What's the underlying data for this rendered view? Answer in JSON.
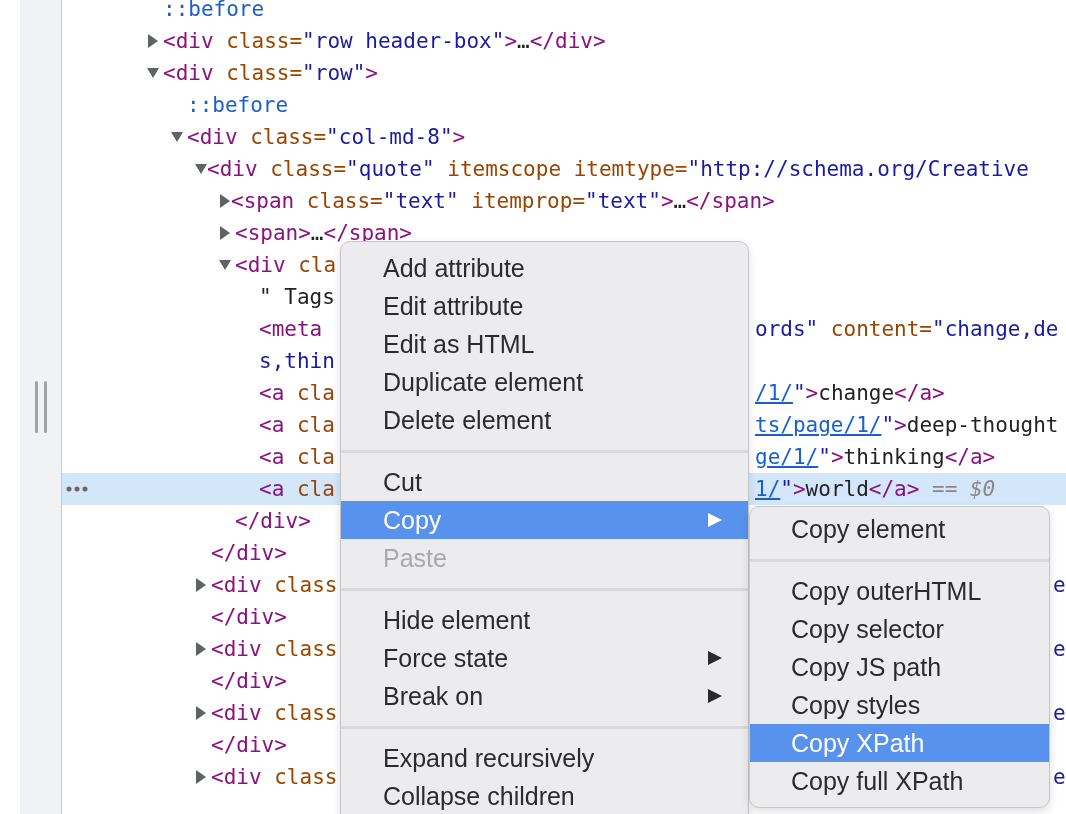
{
  "tree": [
    {
      "selected": false,
      "segments": [
        {
          "kind": "pseudo",
          "text": "::before"
        }
      ]
    },
    {
      "selected": false,
      "expanded": false,
      "segments": [
        {
          "kind": "tag",
          "text": "<div"
        },
        {
          "kind": "attr",
          "text": " class="
        },
        {
          "kind": "value",
          "text": "\"row header-box\""
        },
        {
          "kind": "tag",
          "text": ">"
        },
        {
          "kind": "text",
          "text": "…"
        },
        {
          "kind": "tag",
          "text": "</div>"
        }
      ]
    },
    {
      "selected": false,
      "expanded": true,
      "segments": [
        {
          "kind": "tag",
          "text": "<div"
        },
        {
          "kind": "attr",
          "text": " class="
        },
        {
          "kind": "value",
          "text": "\"row\""
        },
        {
          "kind": "tag",
          "text": ">"
        }
      ],
      "children": [
        {
          "selected": false,
          "segments": [
            {
              "kind": "pseudo",
              "text": "::before"
            }
          ]
        },
        {
          "selected": false,
          "expanded": true,
          "segments": [
            {
              "kind": "tag",
              "text": "<div"
            },
            {
              "kind": "attr",
              "text": " class="
            },
            {
              "kind": "value",
              "text": "\"col-md-8\""
            },
            {
              "kind": "tag",
              "text": ">"
            }
          ],
          "children": [
            {
              "selected": false,
              "expanded": true,
              "segments": [
                {
                  "kind": "tag",
                  "text": "<div"
                },
                {
                  "kind": "attr",
                  "text": " class="
                },
                {
                  "kind": "value",
                  "text": "\"quote\""
                },
                {
                  "kind": "attr",
                  "text": " itemscope"
                },
                {
                  "kind": "attr",
                  "text": " itemtype="
                },
                {
                  "kind": "value",
                  "text": "\"http://schema.org/Creative"
                }
              ],
              "closing": [
                {
                  "kind": "tag",
                  "text": "</div>"
                }
              ],
              "children": [
                {
                  "selected": false,
                  "expanded": false,
                  "segments": [
                    {
                      "kind": "tag",
                      "text": "<span"
                    },
                    {
                      "kind": "attr",
                      "text": " class="
                    },
                    {
                      "kind": "value",
                      "text": "\"text\""
                    },
                    {
                      "kind": "attr",
                      "text": " itemprop="
                    },
                    {
                      "kind": "value",
                      "text": "\"text\""
                    },
                    {
                      "kind": "tag",
                      "text": ">"
                    },
                    {
                      "kind": "text",
                      "text": "…"
                    },
                    {
                      "kind": "tag",
                      "text": "</span>"
                    }
                  ]
                },
                {
                  "selected": false,
                  "expanded": false,
                  "segments": [
                    {
                      "kind": "tag",
                      "text": "<span>"
                    },
                    {
                      "kind": "text",
                      "text": "…"
                    },
                    {
                      "kind": "tag",
                      "text": "</span>"
                    }
                  ]
                },
                {
                  "selected": false,
                  "expanded": true,
                  "segments": [
                    {
                      "kind": "tag",
                      "text": "<div"
                    },
                    {
                      "kind": "attr",
                      "text": " cla"
                    }
                  ],
                  "closing": [
                    {
                      "kind": "tag",
                      "text": "</div>"
                    }
                  ],
                  "children": [
                    {
                      "selected": false,
                      "segments": [
                        {
                          "kind": "text",
                          "text": "\" Tags"
                        }
                      ]
                    },
                    {
                      "selected": false,
                      "segments": [
                        {
                          "kind": "tag",
                          "text": "<meta"
                        }
                      ],
                      "right": [
                        {
                          "kind": "value",
                          "text": "ords\""
                        },
                        {
                          "kind": "attr",
                          "text": " content="
                        },
                        {
                          "kind": "value",
                          "text": "\"change,de"
                        }
                      ],
                      "wrap": [
                        {
                          "kind": "value",
                          "text": "s,thin"
                        }
                      ]
                    },
                    {
                      "selected": false,
                      "segments": [
                        {
                          "kind": "tag",
                          "text": "<a"
                        },
                        {
                          "kind": "attr",
                          "text": " cla"
                        }
                      ],
                      "right": [
                        {
                          "kind": "link",
                          "text": "/1/"
                        },
                        {
                          "kind": "value",
                          "text": "\""
                        },
                        {
                          "kind": "tag",
                          "text": ">"
                        },
                        {
                          "kind": "text",
                          "text": "change"
                        },
                        {
                          "kind": "tag",
                          "text": "</a>"
                        }
                      ]
                    },
                    {
                      "selected": false,
                      "segments": [
                        {
                          "kind": "tag",
                          "text": "<a"
                        },
                        {
                          "kind": "attr",
                          "text": " cla"
                        }
                      ],
                      "right": [
                        {
                          "kind": "link",
                          "text": "ts/page/1/"
                        },
                        {
                          "kind": "value",
                          "text": "\""
                        },
                        {
                          "kind": "tag",
                          "text": ">"
                        },
                        {
                          "kind": "text",
                          "text": "deep-thought"
                        }
                      ]
                    },
                    {
                      "selected": false,
                      "segments": [
                        {
                          "kind": "tag",
                          "text": "<a"
                        },
                        {
                          "kind": "attr",
                          "text": " cla"
                        }
                      ],
                      "right": [
                        {
                          "kind": "link",
                          "text": "ge/1/"
                        },
                        {
                          "kind": "value",
                          "text": "\""
                        },
                        {
                          "kind": "tag",
                          "text": ">"
                        },
                        {
                          "kind": "text",
                          "text": "thinking"
                        },
                        {
                          "kind": "tag",
                          "text": "</a>"
                        }
                      ]
                    },
                    {
                      "selected": true,
                      "segments": [
                        {
                          "kind": "tag",
                          "text": "<a"
                        },
                        {
                          "kind": "attr",
                          "text": " cla"
                        }
                      ],
                      "right": [
                        {
                          "kind": "link",
                          "text": "1/"
                        },
                        {
                          "kind": "value",
                          "text": "\""
                        },
                        {
                          "kind": "tag",
                          "text": ">"
                        },
                        {
                          "kind": "text",
                          "text": "world"
                        },
                        {
                          "kind": "tag",
                          "text": "</a>"
                        },
                        {
                          "kind": "hint",
                          "text": " == $0"
                        }
                      ]
                    }
                  ]
                }
              ]
            },
            {
              "selected": false,
              "expanded": false,
              "segments": [
                {
                  "kind": "tag",
                  "text": "<div"
                },
                {
                  "kind": "attr",
                  "text": " class"
                }
              ],
              "far": [
                {
                  "kind": "value",
                  "text": "e"
                }
              ],
              "wrap": [
                {
                  "kind": "tag",
                  "text": "</div>"
                }
              ]
            },
            {
              "selected": false,
              "expanded": false,
              "segments": [
                {
                  "kind": "tag",
                  "text": "<div"
                },
                {
                  "kind": "attr",
                  "text": " class"
                }
              ],
              "far": [
                {
                  "kind": "value",
                  "text": "e"
                }
              ],
              "wrap": [
                {
                  "kind": "tag",
                  "text": "</div>"
                }
              ]
            },
            {
              "selected": false,
              "expanded": false,
              "segments": [
                {
                  "kind": "tag",
                  "text": "<div"
                },
                {
                  "kind": "attr",
                  "text": " class"
                }
              ],
              "far": [
                {
                  "kind": "value",
                  "text": "e"
                }
              ],
              "wrap": [
                {
                  "kind": "tag",
                  "text": "</div>"
                }
              ]
            },
            {
              "selected": false,
              "expanded": false,
              "segments": [
                {
                  "kind": "tag",
                  "text": "<div"
                },
                {
                  "kind": "attr",
                  "text": " class"
                }
              ],
              "far": [
                {
                  "kind": "value",
                  "text": "e"
                }
              ]
            }
          ]
        }
      ]
    }
  ],
  "context_menu": {
    "items": [
      {
        "kind": "item",
        "label": "Add attribute",
        "selected": false,
        "disabled": false,
        "has_submenu": false
      },
      {
        "kind": "item",
        "label": "Edit attribute",
        "selected": false,
        "disabled": false,
        "has_submenu": false
      },
      {
        "kind": "item",
        "label": "Edit as HTML",
        "selected": false,
        "disabled": false,
        "has_submenu": false
      },
      {
        "kind": "item",
        "label": "Duplicate element",
        "selected": false,
        "disabled": false,
        "has_submenu": false
      },
      {
        "kind": "item",
        "label": "Delete element",
        "selected": false,
        "disabled": false,
        "has_submenu": false
      },
      {
        "kind": "separator"
      },
      {
        "kind": "item",
        "label": "Cut",
        "selected": false,
        "disabled": false,
        "has_submenu": false
      },
      {
        "kind": "item",
        "label": "Copy",
        "selected": true,
        "disabled": false,
        "has_submenu": true
      },
      {
        "kind": "item",
        "label": "Paste",
        "selected": false,
        "disabled": true,
        "has_submenu": false
      },
      {
        "kind": "separator"
      },
      {
        "kind": "item",
        "label": "Hide element",
        "selected": false,
        "disabled": false,
        "has_submenu": false
      },
      {
        "kind": "item",
        "label": "Force state",
        "selected": false,
        "disabled": false,
        "has_submenu": true
      },
      {
        "kind": "item",
        "label": "Break on",
        "selected": false,
        "disabled": false,
        "has_submenu": true
      },
      {
        "kind": "separator"
      },
      {
        "kind": "item",
        "label": "Expand recursively",
        "selected": false,
        "disabled": false,
        "has_submenu": false
      },
      {
        "kind": "item",
        "label": "Collapse children",
        "selected": false,
        "disabled": false,
        "has_submenu": false
      }
    ]
  },
  "submenu": {
    "items": [
      {
        "kind": "item",
        "label": "Copy element",
        "selected": false,
        "disabled": false,
        "has_submenu": false
      },
      {
        "kind": "separator"
      },
      {
        "kind": "item",
        "label": "Copy outerHTML",
        "selected": false,
        "disabled": false,
        "has_submenu": false
      },
      {
        "kind": "item",
        "label": "Copy selector",
        "selected": false,
        "disabled": false,
        "has_submenu": false
      },
      {
        "kind": "item",
        "label": "Copy JS path",
        "selected": false,
        "disabled": false,
        "has_submenu": false
      },
      {
        "kind": "item",
        "label": "Copy styles",
        "selected": false,
        "disabled": false,
        "has_submenu": false
      },
      {
        "kind": "item",
        "label": "Copy XPath",
        "selected": true,
        "disabled": false,
        "has_submenu": false
      },
      {
        "kind": "item",
        "label": "Copy full XPath",
        "selected": false,
        "disabled": false,
        "has_submenu": false
      }
    ]
  }
}
